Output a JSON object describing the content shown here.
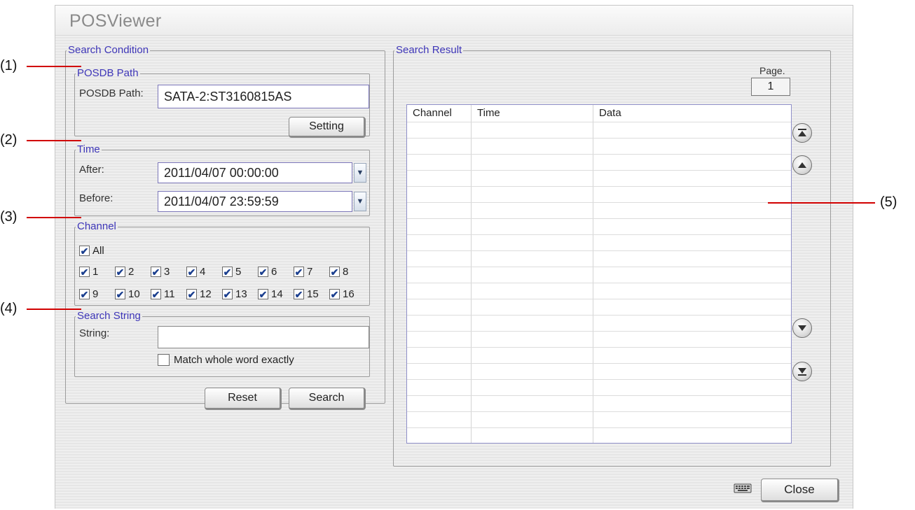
{
  "window": {
    "title": "POSViewer"
  },
  "search_condition": {
    "legend": "Search Condition",
    "posdb": {
      "legend": "POSDB Path",
      "label": "POSDB Path:",
      "value": "SATA-2:ST3160815AS",
      "setting_label": "Setting"
    },
    "time": {
      "legend": "Time",
      "after_label": "After:",
      "after_value": "2011/04/07  00:00:00",
      "before_label": "Before:",
      "before_value": "2011/04/07  23:59:59"
    },
    "channel": {
      "legend": "Channel",
      "all_label": "All",
      "all_checked": true,
      "channels": [
        {
          "label": "1",
          "checked": true
        },
        {
          "label": "2",
          "checked": true
        },
        {
          "label": "3",
          "checked": true
        },
        {
          "label": "4",
          "checked": true
        },
        {
          "label": "5",
          "checked": true
        },
        {
          "label": "6",
          "checked": true
        },
        {
          "label": "7",
          "checked": true
        },
        {
          "label": "8",
          "checked": true
        },
        {
          "label": "9",
          "checked": true
        },
        {
          "label": "10",
          "checked": true
        },
        {
          "label": "11",
          "checked": true
        },
        {
          "label": "12",
          "checked": true
        },
        {
          "label": "13",
          "checked": true
        },
        {
          "label": "14",
          "checked": true
        },
        {
          "label": "15",
          "checked": true
        },
        {
          "label": "16",
          "checked": true
        }
      ]
    },
    "search_string": {
      "legend": "Search String",
      "label": "String:",
      "value": "",
      "match_label": "Match whole word exactly",
      "match_checked": false
    },
    "reset_label": "Reset",
    "search_label": "Search"
  },
  "search_result": {
    "legend": "Search Result",
    "page_label": "Page.",
    "page_value": "1",
    "columns": [
      "Channel",
      "Time",
      "Data"
    ],
    "rows": []
  },
  "footer": {
    "close_label": "Close",
    "keyboard_icon": "keyboard-icon"
  },
  "annotations": [
    "(1)",
    "(2)",
    "(3)",
    "(4)",
    "(5)"
  ],
  "colors": {
    "legend_text": "#3e36b8",
    "annotation_line": "#d10000",
    "input_border": "#7a75b8"
  }
}
